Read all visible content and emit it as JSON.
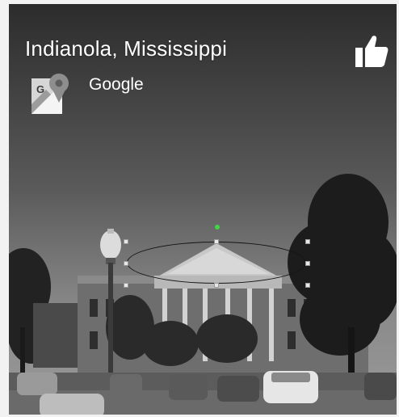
{
  "card": {
    "title": "Indianola, Mississippi",
    "provider": "Google",
    "provider_logo_letter": "G",
    "icons": {
      "like": "thumbs-up-icon",
      "provider_logo": "google-maps-logo-icon"
    }
  },
  "colors": {
    "overlay_text": "#ffffff",
    "selection_handle": "#e8e8e8",
    "rotate_handle": "#42d442"
  }
}
